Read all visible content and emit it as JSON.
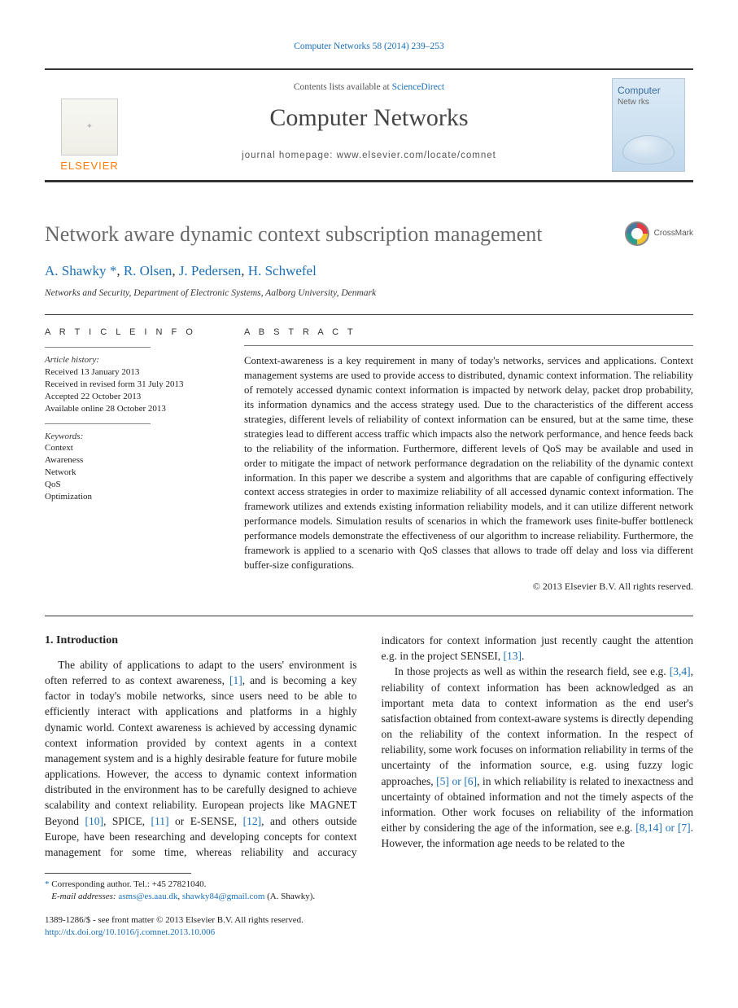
{
  "citation": "Computer Networks 58 (2014) 239–253",
  "header": {
    "contents_prefix": "Contents lists available at ",
    "contents_link": "ScienceDirect",
    "journal": "Computer Networks",
    "homepage_prefix": "journal homepage: ",
    "homepage": "www.elsevier.com/locate/comnet",
    "publisher": "ELSEVIER",
    "cover_title": "Computer",
    "cover_sub": "Netw rks"
  },
  "crossmark_label": "CrossMark",
  "article": {
    "title": "Network aware dynamic context subscription management",
    "authors_html": "A. Shawky *, R. Olsen, J. Pedersen, H. Schwefel",
    "author1": "A. Shawky",
    "star": "*",
    "sep": ", ",
    "author2": "R. Olsen",
    "author3": "J. Pedersen",
    "author4": "H. Schwefel",
    "affiliation": "Networks and Security, Department of Electronic Systems, Aalborg University, Denmark"
  },
  "info_head": "A R T I C L E   I N F O",
  "abs_head": "A B S T R A C T",
  "history": {
    "heading": "Article history:",
    "received": "Received 13 January 2013",
    "revised": "Received in revised form 31 July 2013",
    "accepted": "Accepted 22 October 2013",
    "online": "Available online 28 October 2013"
  },
  "keywords": {
    "heading": "Keywords:",
    "items": [
      "Context",
      "Awareness",
      "Network",
      "QoS",
      "Optimization"
    ]
  },
  "abstract": "Context-awareness is a key requirement in many of today's networks, services and applications. Context management systems are used to provide access to distributed, dynamic context information. The reliability of remotely accessed dynamic context information is impacted by network delay, packet drop probability, its information dynamics and the access strategy used. Due to the characteristics of the different access strategies, different levels of reliability of context information can be ensured, but at the same time, these strategies lead to different access traffic which impacts also the network performance, and hence feeds back to the reliability of the information. Furthermore, different levels of QoS may be available and used in order to mitigate the impact of network performance degradation on the reliability of the dynamic context information. In this paper we describe a system and algorithms that are capable of configuring effectively context access strategies in order to maximize reliability of all accessed dynamic context information. The framework utilizes and extends existing information reliability models, and it can utilize different network performance models. Simulation results of scenarios in which the framework uses finite-buffer bottleneck performance models demonstrate the effectiveness of our algorithm to increase reliability. Furthermore, the framework is applied to a scenario with QoS classes that allows to trade off delay and loss via different buffer-size configurations.",
  "copyright": "© 2013 Elsevier B.V. All rights reserved.",
  "section1": {
    "heading": "1. Introduction",
    "p1a": "The ability of applications to adapt to the users' environment is often referred to as context awareness, ",
    "ref1": "[1]",
    "p1b": ", and is becoming a key factor in today's mobile networks, since users need to be able to efficiently interact with applications and platforms in a highly dynamic world. Context awareness is achieved by accessing dynamic context information provided by context agents in a context management system and is a highly desirable feature for future mobile applications. However, the access to dynamic context information distributed in the environment has to be carefully designed to achieve scalability and context reliability. European projects like MAGNET Beyond ",
    "ref10": "[10]",
    "p1c": ", SPICE, ",
    "ref11": "[11]",
    "p1d": " or E-SENSE, ",
    "ref12": "[12]",
    "p1e": ", and others outside Europe, have been researching and developing concepts for context management for some time, whereas reliability and accuracy indicators for context information just recently caught the attention e.g. in the project SENSEI, ",
    "ref13": "[13]",
    "p1f": ".",
    "p2a": "In those projects as well as within the research field, see e.g. ",
    "ref34": "[3,4]",
    "p2b": ", reliability of context information has been acknowledged as an important meta data to context information as the end user's satisfaction obtained from context-aware systems is directly depending on the reliability of the context information. In the respect of reliability, some work focuses on information reliability in terms of the uncertainty of the information source, e.g. using fuzzy logic approaches, ",
    "ref5or6": "[5] or [6]",
    "p2c": ", in which reliability is related to inexactness and uncertainty of obtained information and not the timely aspects of the information. Other work focuses on reliability of the information either by considering the age of the information, see e.g. ",
    "ref814or7": "[8,14] or [7]",
    "p2d": ". However, the information age needs to be related to the"
  },
  "footnote": {
    "corr_label": "Corresponding author. Tel.: +45 27821040.",
    "email_label": "E-mail addresses:",
    "email1": "asms@es.aau.dk",
    "email2": "shawky84@gmail.com",
    "email_tail": " (A. Shawky)."
  },
  "footer": {
    "issn_line": "1389-1286/$ - see front matter © 2013 Elsevier B.V. All rights reserved.",
    "doi": "http://dx.doi.org/10.1016/j.comnet.2013.10.006"
  }
}
